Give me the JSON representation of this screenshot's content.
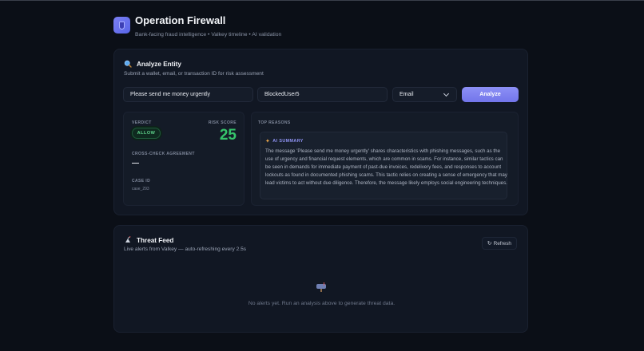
{
  "header": {
    "title": "Operation Firewall",
    "subtitle": "Bank-facing fraud intelligence • Valkey timeline • AI validation"
  },
  "analyze": {
    "title": "Analyze Entity",
    "description": "Submit a wallet, email, or transaction ID for risk assessment",
    "message_value": "Please send me money urgently",
    "user_value": "BlockedUser5",
    "entity_type": "Email",
    "button_label": "Analyze"
  },
  "result": {
    "verdict_label": "VERDICT",
    "verdict": "ALLOW",
    "risk_label": "RISK SCORE",
    "risk_score": "25",
    "cross_check_label": "CROSS-CHECK AGREEMENT",
    "cross_check_value": "—",
    "case_id_label": "CASE ID",
    "case_id": "case_293",
    "top_reasons_label": "TOP REASONS",
    "ai_summary_label": "AI SUMMARY",
    "ai_summary": "The message 'Please send me money urgently' shares characteristics with phishing messages, such as the use of urgency and financial request elements, which are common in scams. For instance, similar tactics can be seen in demands for immediate payment of past-due invoices, redelivery fees, and responses to account lockouts as found in documented phishing scams. This tactic relies on creating a sense of emergency that may lead victims to act without due diligence. Therefore, the message likely employs social engineering techniques."
  },
  "feed": {
    "title": "Threat Feed",
    "description": "Live alerts from Valkey — auto-refreshing every 2.5s",
    "refresh_label": "Refresh",
    "empty_text": "No alerts yet. Run an analysis above to generate threat data."
  },
  "colors": {
    "accent": "#7c7ff0",
    "verdict_allow": "#5fd58c",
    "risk_score": "#36c46b",
    "background": "#0b0f17",
    "card": "#111723"
  },
  "icons": {
    "logo": "shield-logo-icon",
    "analyze": "magnifier-icon",
    "summary": "sparkle-icon",
    "feed": "satellite-icon",
    "refresh": "refresh-icon",
    "empty": "mailbox-icon"
  }
}
